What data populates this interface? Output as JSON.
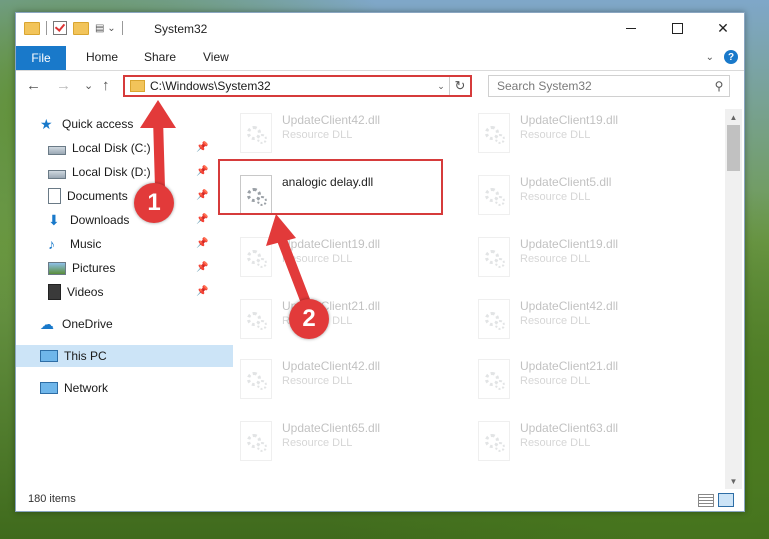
{
  "window": {
    "title": "System32"
  },
  "ribbon": {
    "tabs": [
      "File",
      "Home",
      "Share",
      "View"
    ]
  },
  "nav": {
    "back": "←",
    "forward": "→",
    "recent": "⌄",
    "up": "↑",
    "address": "C:\\Windows\\System32",
    "address_chevron": "⌄",
    "refresh": "↻",
    "search_placeholder": "Search System32"
  },
  "sidebar": {
    "items": [
      {
        "label": "Quick access",
        "icon": "star-icon"
      },
      {
        "label": "Local Disk (C:)",
        "icon": "drive-icon",
        "pinned": true
      },
      {
        "label": "Local Disk (D:)",
        "icon": "drive-icon",
        "pinned": true
      },
      {
        "label": "Documents",
        "icon": "documents-icon",
        "pinned": true
      },
      {
        "label": "Downloads",
        "icon": "download-icon",
        "pinned": true
      },
      {
        "label": "Music",
        "icon": "music-icon",
        "pinned": true
      },
      {
        "label": "Pictures",
        "icon": "pictures-icon",
        "pinned": true
      },
      {
        "label": "Videos",
        "icon": "videos-icon",
        "pinned": true
      },
      {
        "label": "OneDrive",
        "icon": "cloud-icon"
      },
      {
        "label": "This PC",
        "icon": "computer-icon",
        "selected": true
      },
      {
        "label": "Network",
        "icon": "network-icon"
      }
    ]
  },
  "files": [
    {
      "name": "UpdateClient42.dll",
      "type": "Resource DLL"
    },
    {
      "name": "UpdateClient19.dll",
      "type": "Resource DLL"
    },
    {
      "name": "analogic delay.dll",
      "type": ""
    },
    {
      "name": "UpdateClient5.dll",
      "type": "Resource DLL"
    },
    {
      "name": "UpdateClient19.dll",
      "type": "Resource DLL"
    },
    {
      "name": "UpdateClient19.dll",
      "type": "Resource DLL"
    },
    {
      "name": "UpdateClient21.dll",
      "type": "Resource DLL"
    },
    {
      "name": "UpdateClient42.dll",
      "type": "Resource DLL"
    },
    {
      "name": "UpdateClient42.dll",
      "type": "Resource DLL"
    },
    {
      "name": "UpdateClient21.dll",
      "type": "Resource DLL"
    },
    {
      "name": "UpdateClient65.dll",
      "type": "Resource DLL"
    },
    {
      "name": "UpdateClient63.dll",
      "type": "Resource DLL"
    }
  ],
  "status": {
    "item_count": "180 items"
  },
  "annotations": {
    "step1": "1",
    "step2": "2"
  },
  "colors": {
    "accent": "#1979ca",
    "highlight": "#d63b3b",
    "badge": "#e23a3a"
  }
}
